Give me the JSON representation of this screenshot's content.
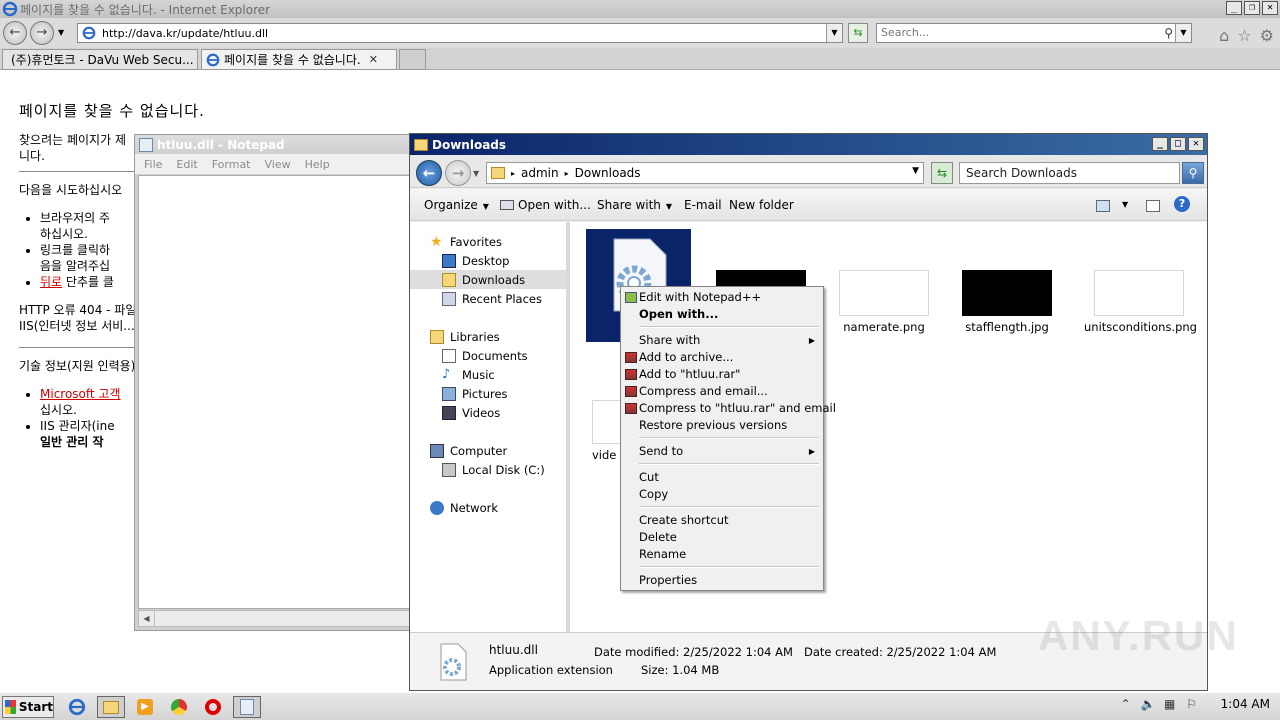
{
  "ie": {
    "title": "페이지를 찾을 수 없습니다. - Internet Explorer",
    "address": "http://dava.kr/update/htluu.dll",
    "search_placeholder": "Search...",
    "tabs": [
      {
        "label": "(주)휴먼토크 - DaVu Web Secu..."
      },
      {
        "label": "페이지를 찾을 수 없습니다."
      }
    ]
  },
  "page": {
    "heading": "페이지를 찾을 수 없습니다.",
    "line1a": "찾으려는 페이지가 제",
    "line1b": "니다.",
    "try_text": "다음을 시도하십시오",
    "bullets": [
      {
        "a": "브라우저의 주",
        "b": "하십시오."
      },
      {
        "a": "링크를 클릭하",
        "b": "음을 알려주십"
      },
      {
        "link": "뒤로",
        "rest": " 단추를 클"
      }
    ],
    "http_error": "HTTP 오류 404 - 파일",
    "iis_text": "IIS(인터넷 정보 서비...",
    "tech_info": "기술 정보(지원 인력용)",
    "tech_bullets": [
      {
        "link": "Microsoft 고객",
        "b": "십시오."
      },
      {
        "a": "IIS 관리자(ine",
        "b": "일반 관리 작"
      }
    ]
  },
  "notepad": {
    "title": "htluu.dll - Notepad",
    "menu": [
      "File",
      "Edit",
      "Format",
      "View",
      "Help"
    ]
  },
  "explorer": {
    "title": "Downloads",
    "path": [
      "admin",
      "Downloads"
    ],
    "search_placeholder": "Search Downloads",
    "toolbar": {
      "organize": "Organize",
      "open_with": "Open with...",
      "share_with": "Share with",
      "email": "E-mail",
      "new_folder": "New folder"
    },
    "nav": {
      "favorites": "Favorites",
      "desktop": "Desktop",
      "downloads": "Downloads",
      "recent_places": "Recent Places",
      "libraries": "Libraries",
      "documents": "Documents",
      "music": "Music",
      "pictures": "Pictures",
      "videos": "Videos",
      "computer": "Computer",
      "local_disk": "Local Disk (C:)",
      "network": "Network"
    },
    "files": {
      "namerate": "namerate.png",
      "stafflength": "stafflength.jpg",
      "units": "unitsconditions.png",
      "vide": "vide"
    },
    "details": {
      "name": "htluu.dll",
      "type": "Application extension",
      "modified": "Date modified: 2/25/2022 1:04 AM",
      "created": "Date created: 2/25/2022 1:04 AM",
      "size": "Size: 1.04 MB"
    }
  },
  "context_menu": {
    "edit_npp": "Edit with Notepad++",
    "open_with": "Open with...",
    "share_with": "Share with",
    "add_archive": "Add to archive...",
    "add_rar": "Add to \"htluu.rar\"",
    "compress_email": "Compress and email...",
    "compress_rar_email": "Compress to \"htluu.rar\" and email",
    "restore": "Restore previous versions",
    "send_to": "Send to",
    "cut": "Cut",
    "copy": "Copy",
    "create_shortcut": "Create shortcut",
    "delete": "Delete",
    "rename": "Rename",
    "properties": "Properties"
  },
  "watermark": "ANY.RUN",
  "taskbar": {
    "start": "Start",
    "clock": "1:04 AM"
  }
}
